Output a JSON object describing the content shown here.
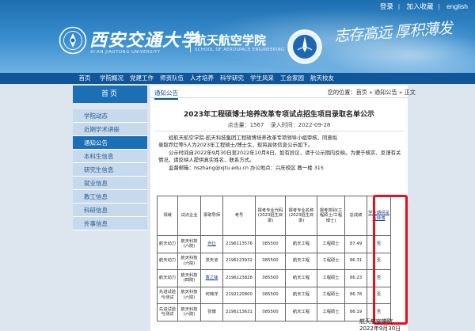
{
  "toplinks": {
    "login": "登录",
    "favorite": "加入收藏",
    "english": "english"
  },
  "header": {
    "university_name": "西安交通大学",
    "university_en": "XI'AN JIAOTONG UNIVERSITY",
    "school_name": "航天航空学院",
    "school_en": "SCHOOL OF AEROSPACE ENGINEERING",
    "calligraphy": "志存高远 厚积薄发"
  },
  "nav": [
    "首页",
    "学院概况",
    "党建工作",
    "师资队伍",
    "人才培养",
    "科学研究",
    "学生风采",
    "工会家园",
    "航天校友"
  ],
  "sidebar": {
    "title": "首页",
    "items": [
      "学院动态",
      "近期学术讲座",
      "通知公告",
      "本科生信息",
      "研究生信息",
      "就业信息",
      "教工信息",
      "科研信息",
      "外事信息"
    ],
    "active": 2
  },
  "breadcrumb": {
    "tab": "通知公告",
    "path": "您的位置：首页 » 通知公告 » 正文"
  },
  "article": {
    "title": "2023年工程硕博士培养改革专项试点招生项目录取名单公示",
    "views": "点击量：1567",
    "date": "录入时间：2022-09-28",
    "para1": "经航天航空学院-航天科技集团工程硕博培养改革专项领导小组审核，同意拟",
    "para2": "录取乔灶等5人为2023年工程硕士/博士生，现将具体信息公示如下。",
    "para3": "公示时间自2022年9月30日至2022年10月8日，如有异议，请于公示期内反映。为便于核实、反馈有关",
    "para4": "情况，请反映人提供真实姓名、联系方式。",
    "para5": "监督邮箱：hszhang@xjtu.edu.cn  办公地点：兴庆校区 教一楼  315"
  },
  "table": {
    "headers": [
      "领域",
      "试点企业",
      "录取导师",
      "考号",
      "报考专业代码(2023招生目录)",
      "报考专业名称(2023招生目录)",
      "报考类别(工程硕士/工程博士)",
      "总成绩",
      "学业期间是否转博"
    ],
    "rows": [
      [
        "航天动力",
        "航天科技(六院)",
        "乔灶",
        "2196113576",
        "085500",
        "航天工程",
        "工程硕士",
        "87.49",
        "否"
      ],
      [
        "航天动力",
        "航天科技(六院)",
        "张天池",
        "2196123932",
        "085500",
        "航天工程",
        "工程硕士",
        "86.31",
        "否"
      ],
      [
        "航天动力",
        "航天科技(四院)",
        "曹之锋",
        "2196123828",
        "085500",
        "航天工程",
        "工程硕士",
        "86.23",
        "否"
      ],
      [
        "先进试验与测试",
        "航天科技(六院)",
        "何锦洋",
        "2192120800",
        "085500",
        "航天工程",
        "工程硕士",
        "86.78",
        "否"
      ],
      [
        "先进试验与测试",
        "航天科技(六院)",
        "张博",
        "2196113631",
        "085500",
        "航天工程",
        "工程硕士",
        "86.19",
        "否"
      ]
    ]
  },
  "signature": {
    "org": "航天航空学院",
    "date": "2022年9月30日"
  },
  "colors": {
    "nav": "#12569a",
    "sidebar_active": "#1a6fb5",
    "sidebar_item": "#c7d9ec",
    "highlight": "#e8101a"
  }
}
